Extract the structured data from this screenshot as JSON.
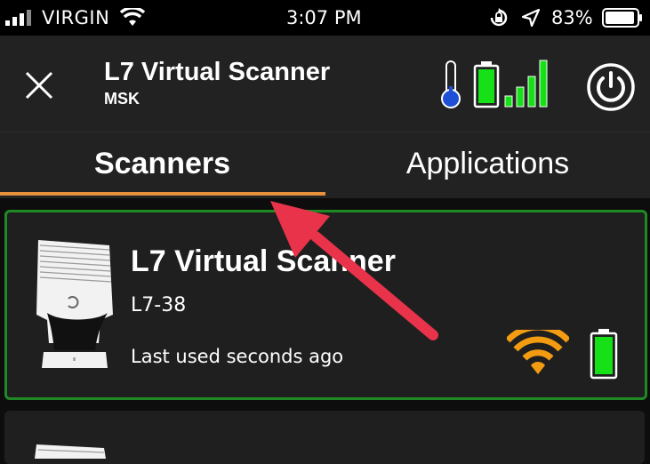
{
  "status_bar": {
    "carrier": "VIRGIN",
    "time": "3:07 PM",
    "battery_percent": "83%",
    "icons": [
      "cell-signal-icon",
      "wifi-icon",
      "orientation-lock-icon",
      "location-arrow-icon",
      "battery-icon"
    ]
  },
  "header": {
    "title": "L7 Virtual Scanner",
    "subtitle": "MSK",
    "icons": [
      "close-icon",
      "thermometer-icon",
      "battery-icon",
      "signal-bars-icon",
      "power-icon"
    ]
  },
  "tabs": [
    {
      "label": "Scanners",
      "active": true
    },
    {
      "label": "Applications",
      "active": false
    }
  ],
  "colors": {
    "accent": "#e8913c",
    "connected_border": "#1f8a24",
    "battery_green": "#16e016",
    "annotation_arrow": "#e8334a"
  },
  "scanners": [
    {
      "name": "L7 Virtual Scanner",
      "model": "L7-38",
      "last_used": "Last used seconds ago",
      "connection_icon": "wifi-icon",
      "battery_icon": "battery-icon"
    }
  ]
}
